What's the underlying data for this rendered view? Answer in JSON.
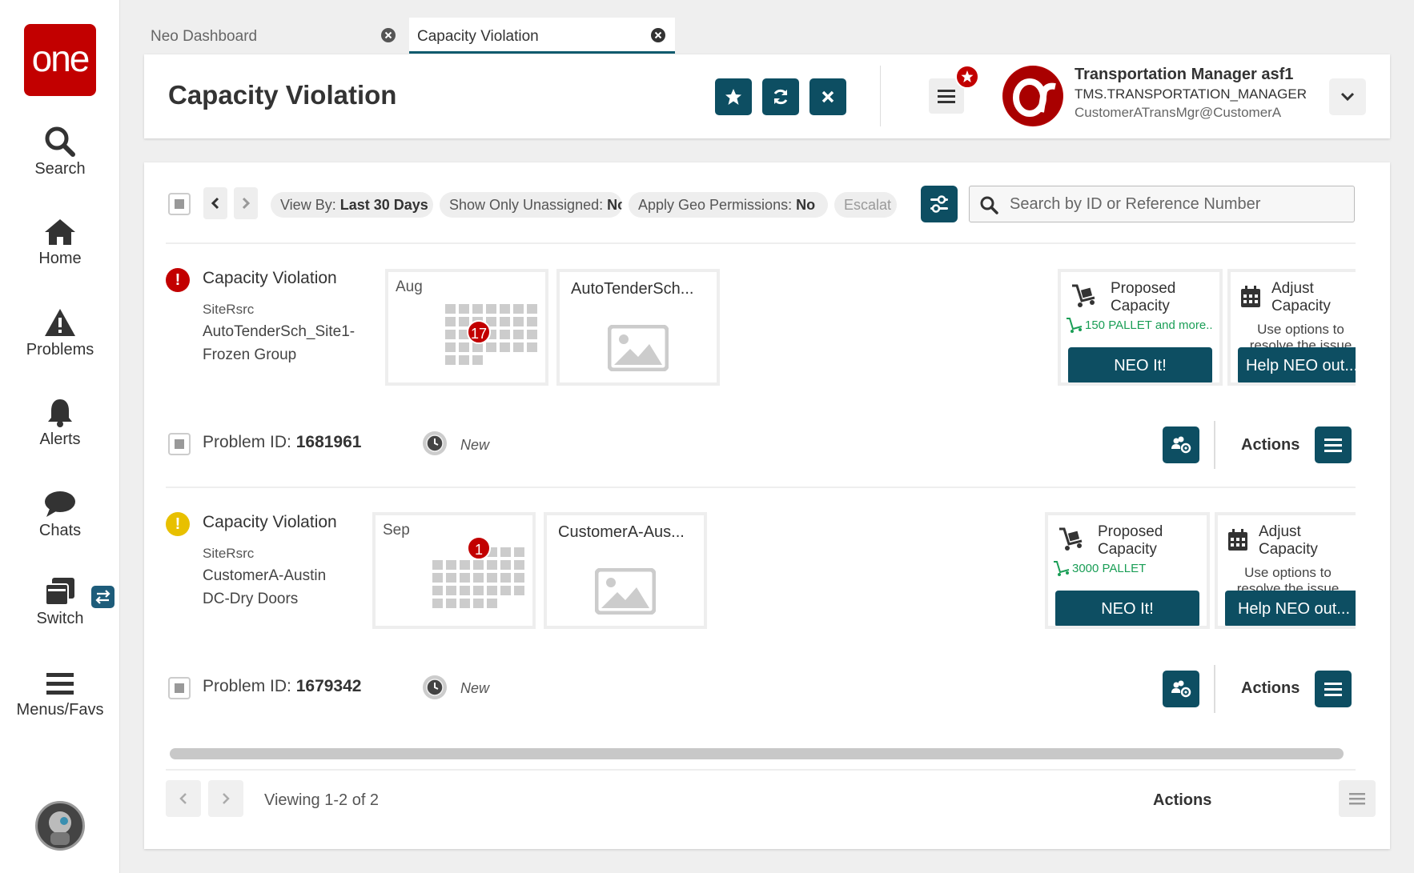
{
  "sidebar": {
    "logo": "one",
    "items": [
      {
        "label": "Search",
        "icon": "search-icon"
      },
      {
        "label": "Home",
        "icon": "home-icon"
      },
      {
        "label": "Problems",
        "icon": "warning-icon"
      },
      {
        "label": "Alerts",
        "icon": "bell-icon"
      },
      {
        "label": "Chats",
        "icon": "chat-icon"
      },
      {
        "label": "Switch",
        "icon": "switch-icon"
      },
      {
        "label": "Menus/Favs",
        "icon": "menu-icon"
      }
    ]
  },
  "tabs": [
    {
      "label": "Neo Dashboard",
      "active": false
    },
    {
      "label": "Capacity Violation",
      "active": true
    }
  ],
  "header": {
    "title": "Capacity Violation",
    "user": {
      "name": "Transportation Manager asf1",
      "role": "TMS.TRANSPORTATION_MANAGER",
      "email": "CustomerATransMgr@CustomerA"
    }
  },
  "toolbar": {
    "chips": [
      {
        "label": "View By:",
        "value": "Last 30 Days"
      },
      {
        "label": "Show Only Unassigned:",
        "value": "No"
      },
      {
        "label": "Apply Geo Permissions:",
        "value": "No"
      },
      {
        "label": "Escalat",
        "value": ""
      }
    ],
    "search_placeholder": "Search by ID or Reference Number"
  },
  "problems": [
    {
      "title": "Capacity Violation",
      "severity": "high",
      "severity_color": "#c20000",
      "label": "SiteRsrc",
      "value_line1": "AutoTenderSch_Site1-",
      "value_line2": "Frozen Group",
      "month": "Aug",
      "count": "17",
      "tile_name": "AutoTenderSch...",
      "proposed_title_1": "Proposed",
      "proposed_title_2": "Capacity",
      "proposed_detail": "150 PALLET and more..",
      "neo_button": "NEO It!",
      "adjust_title_1": "Adjust",
      "adjust_title_2": "Capacity",
      "adjust_sub_1": "Use options to",
      "adjust_sub_2": "resolve the issue",
      "help_button": "Help NEO out...",
      "pid_label": "Problem ID:",
      "pid": "1681961",
      "status": "New",
      "actions": "Actions"
    },
    {
      "title": "Capacity Violation",
      "severity": "medium",
      "severity_color": "#e8c000",
      "label": "SiteRsrc",
      "value_line1": "CustomerA-Austin",
      "value_line2": "DC-Dry Doors",
      "month": "Sep",
      "count": "1",
      "tile_name": "CustomerA-Aus...",
      "proposed_title_1": "Proposed",
      "proposed_title_2": "Capacity",
      "proposed_detail": "3000 PALLET",
      "neo_button": "NEO It!",
      "adjust_title_1": "Adjust",
      "adjust_title_2": "Capacity",
      "adjust_sub_1": "Use options to",
      "adjust_sub_2": "resolve the issue",
      "help_button": "Help NEO out...",
      "pid_label": "Problem ID:",
      "pid": "1679342",
      "status": "New",
      "actions": "Actions"
    }
  ],
  "footer": {
    "viewing": "Viewing 1-2 of 2",
    "actions": "Actions"
  },
  "colors": {
    "brand": "#c20000",
    "accent": "#0d4e62"
  }
}
